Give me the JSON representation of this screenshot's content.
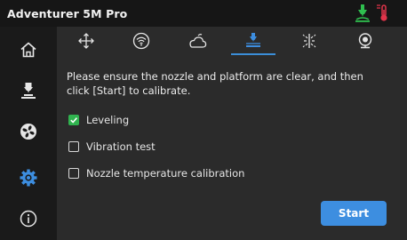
{
  "app": {
    "title": "Adventurer 5M Pro"
  },
  "status_icons": [
    "nozzle-status-icon",
    "thermometer-icon"
  ],
  "sidebar": {
    "items": [
      {
        "name": "home",
        "icon": "home-icon",
        "active": false
      },
      {
        "name": "print-nozzle",
        "icon": "nozzle-icon",
        "active": false
      },
      {
        "name": "fan",
        "icon": "fan-icon",
        "active": false
      },
      {
        "name": "settings",
        "icon": "gear-icon",
        "active": true
      },
      {
        "name": "info",
        "icon": "info-icon",
        "active": false
      }
    ]
  },
  "tabs": [
    {
      "name": "move",
      "icon": "move-arrows-icon",
      "active": false
    },
    {
      "name": "wifi",
      "icon": "wifi-icon",
      "active": false
    },
    {
      "name": "cloud",
      "icon": "cloud-icon",
      "active": false
    },
    {
      "name": "calibration",
      "icon": "calibration-icon",
      "active": true
    },
    {
      "name": "light",
      "icon": "light-icon",
      "active": false
    },
    {
      "name": "camera",
      "icon": "camera-icon",
      "active": false
    }
  ],
  "calibration": {
    "message": "Please ensure the nozzle and platform are clear, and then click [Start] to calibrate.",
    "options": [
      {
        "label": "Leveling",
        "checked": true
      },
      {
        "label": "Vibration test",
        "checked": false
      },
      {
        "label": "Nozzle temperature calibration",
        "checked": false
      }
    ],
    "start_label": "Start"
  },
  "colors": {
    "accent": "#3d8ee0",
    "check": "#30b34f",
    "status_green": "#2fbf4f",
    "status_red": "#e0344a"
  }
}
